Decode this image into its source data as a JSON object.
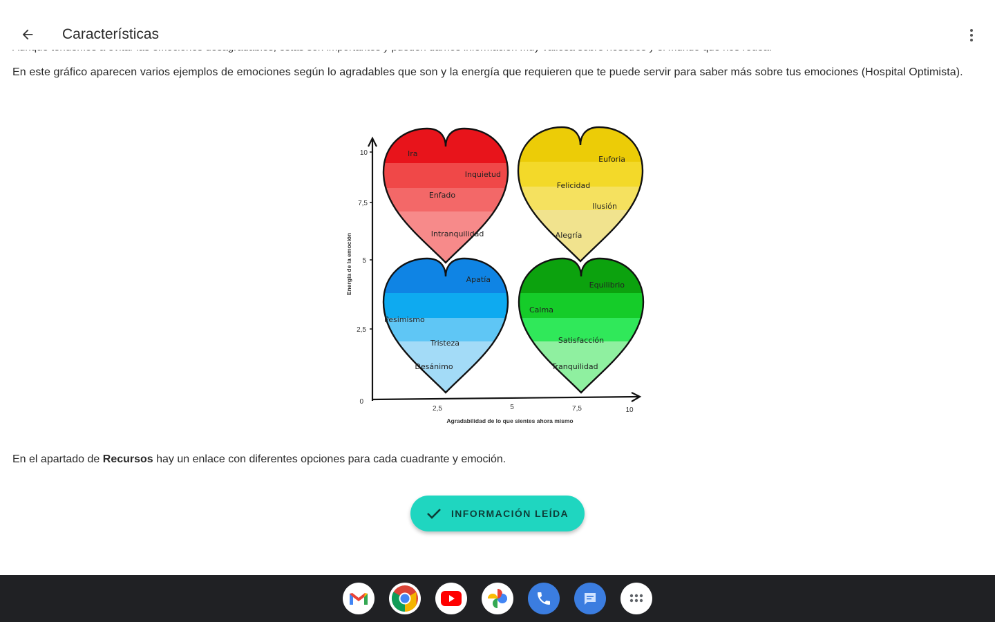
{
  "appbar": {
    "title": "Características"
  },
  "content": {
    "clipped_line": "Aunque tendemos a evitar las emociones desagradables, éstas son importantes y pueden darnos información muy valiosa sobre nosotros y el mundo que nos rodea.",
    "intro_paragraph": "En este gráfico aparecen varios ejemplos de emociones según lo agradables que son y la energía que requieren que te puede servir para saber más sobre tus emociones (Hospital Optimista).",
    "resources_prefix": "En el apartado de ",
    "resources_bold": "Recursos",
    "resources_suffix": " hay un enlace con diferentes opciones para cada cuadrante y emoción."
  },
  "figure": {
    "y_axis_label": "Energía de la emoción",
    "x_axis_label": "Agradabilidad de lo que sientes ahora mismo",
    "y_ticks": [
      "0",
      "2,5",
      "5",
      "7,5",
      "10"
    ],
    "x_ticks": [
      "2,5",
      "5",
      "7,5",
      "10"
    ],
    "hearts": {
      "red": {
        "colors": [
          "#e8141b",
          "#f04848",
          "#f36868",
          "#f78a8a"
        ],
        "labels": [
          "Ira",
          "Inquietud",
          "Enfado",
          "Intranquilidad"
        ]
      },
      "yellow": {
        "colors": [
          "#eccc07",
          "#f3d929",
          "#f5e15f",
          "#f1e38e"
        ],
        "labels": [
          "Euforia",
          "Felicidad",
          "Ilusión",
          "Alegría"
        ]
      },
      "blue": {
        "colors": [
          "#0f84e4",
          "#0eaaf0",
          "#5fc6f5",
          "#a3dbf7"
        ],
        "labels": [
          "Apatía",
          "Pesimismo",
          "Tristeza",
          "Desánimo"
        ]
      },
      "green": {
        "colors": [
          "#0ca20e",
          "#15cc29",
          "#30e85a",
          "#8ff0a0"
        ],
        "labels": [
          "Equilibrio",
          "Calma",
          "Satisfacción",
          "Tranquilidad"
        ]
      }
    }
  },
  "action": {
    "read_button_label": "INFORMACIÓN LEÍDA"
  },
  "colors": {
    "accent": "#1fd6c0",
    "taskbar": "#202124"
  },
  "taskbar": {
    "apps": [
      "gmail-icon",
      "chrome-icon",
      "youtube-icon",
      "photos-icon",
      "phone-icon",
      "messages-icon",
      "app-launcher-icon"
    ]
  }
}
